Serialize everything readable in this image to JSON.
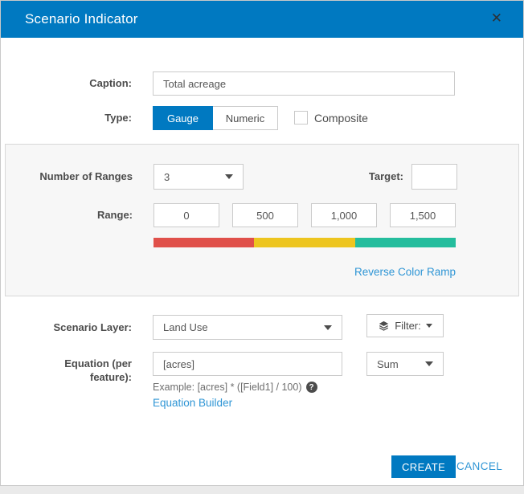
{
  "dialog": {
    "title": "Scenario Indicator",
    "close_icon": "✕"
  },
  "form": {
    "caption_label": "Caption:",
    "caption_value": "Total acreage",
    "type_label": "Type:",
    "type_gauge_label": "Gauge",
    "type_numeric_label": "Numeric",
    "composite_label": "Composite"
  },
  "ranges_panel": {
    "number_of_ranges_label": "Number of Ranges",
    "number_of_ranges_value": "3",
    "target_label": "Target:",
    "target_value": "",
    "range_label": "Range:",
    "range_values": [
      "0",
      "500",
      "1,000",
      "1,500"
    ],
    "ramp_colors": [
      "#e0504a",
      "#edc51f",
      "#24bd9d"
    ],
    "reverse_link_label": "Reverse Color Ramp"
  },
  "layer_section": {
    "scenario_layer_label": "Scenario Layer:",
    "scenario_layer_value": "Land Use",
    "filter_label": "Filter:",
    "equation_label": "Equation (per feature):",
    "equation_value": "[acres]",
    "aggregation_value": "Sum",
    "example_text": "Example: [acres] * ([Field1] / 100)",
    "help_icon_glyph": "?",
    "equation_builder_label": "Equation Builder"
  },
  "footer": {
    "create_label": "CREATE",
    "cancel_label": "CANCEL"
  },
  "colors": {
    "accent": "#0079c1",
    "link": "#2e95d5",
    "ramp_red": "#e0504a",
    "ramp_yellow": "#edc51f",
    "ramp_green": "#24bd9d"
  }
}
